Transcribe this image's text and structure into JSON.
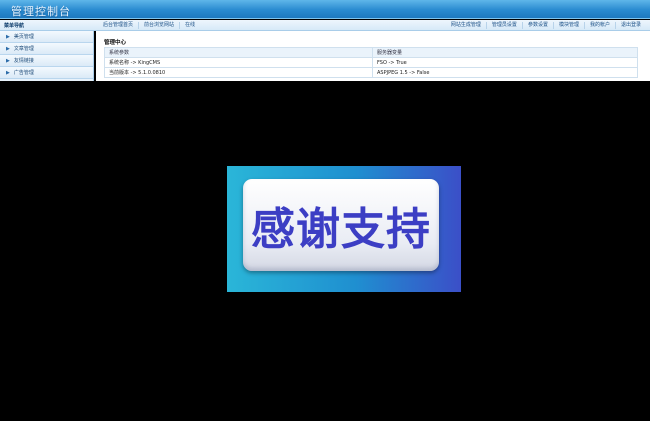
{
  "header": {
    "title": "管理控制台"
  },
  "toolbar": {
    "nav_title": "菜单导航",
    "left_links": [
      "后台管理首页",
      "前台浏览网站",
      "在线"
    ],
    "right_links": [
      "网站生成管理",
      "管理员设置",
      "参数设置",
      "模块管理",
      "我的帐户",
      "退出登录"
    ]
  },
  "sidebar": {
    "items": [
      "美页管理",
      "文章管理",
      "友情链接",
      "广告管理"
    ]
  },
  "main": {
    "panel_title": "管理中心",
    "columns": [
      "系统参数",
      "服务器变量"
    ],
    "rows": [
      [
        "系统名称 -> KingCMS",
        "FSO -> True"
      ],
      [
        "当前版本 -> 5.1.0.0810",
        "ASPJPEG 1.5 -> False"
      ]
    ]
  },
  "overlay": {
    "text": "感谢支持"
  }
}
